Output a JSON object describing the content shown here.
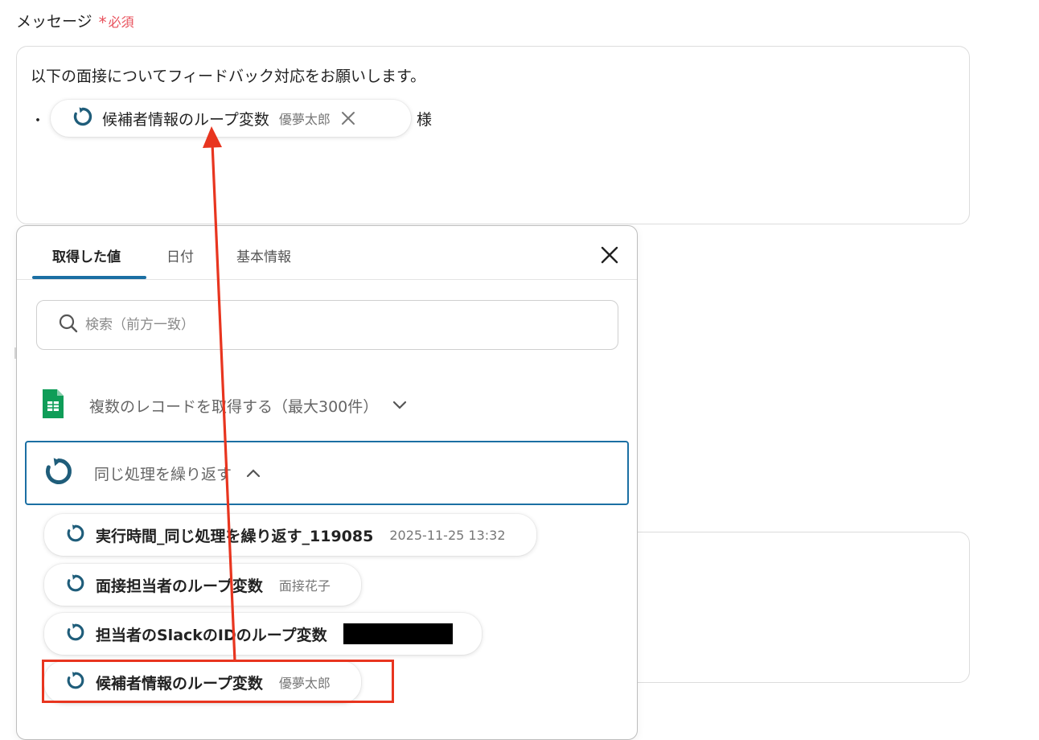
{
  "field": {
    "label": "メッセージ",
    "required_mark": "*",
    "required_text": "必須"
  },
  "message": {
    "line1": "以下の面接についてフィードバック対応をお願いします。",
    "bullet": "・",
    "chip_label": "候補者情報のループ変数",
    "chip_value": "優夢太郎",
    "suffix": "様"
  },
  "picker": {
    "tabs": [
      {
        "label": "取得した値"
      },
      {
        "label": "日付"
      },
      {
        "label": "基本情報"
      }
    ],
    "search_placeholder": "検索（前方一致）",
    "sections": [
      {
        "label": "複数のレコードを取得する（最大300件）",
        "icon": "google-sheets-icon",
        "expanded": false
      },
      {
        "label": "同じ処理を繰り返す",
        "icon": "loop-icon",
        "expanded": true
      }
    ],
    "items": [
      {
        "label": "実行時間_同じ処理を繰り返す_119085",
        "value": "2025-11-25 13:32"
      },
      {
        "label": "面接担当者のループ変数",
        "value": "面接花子"
      },
      {
        "label": "担当者のSlackのIDのループ変数",
        "value": "",
        "redacted": true
      },
      {
        "label": "候補者情報のループ変数",
        "value": "優夢太郎"
      }
    ]
  },
  "colors": {
    "accent": "#1b6fa3",
    "loop_icon": "#1f5d7a",
    "required": "#e8505b",
    "annotation": "#e8351f",
    "sheets_green": "#0f9d58"
  }
}
